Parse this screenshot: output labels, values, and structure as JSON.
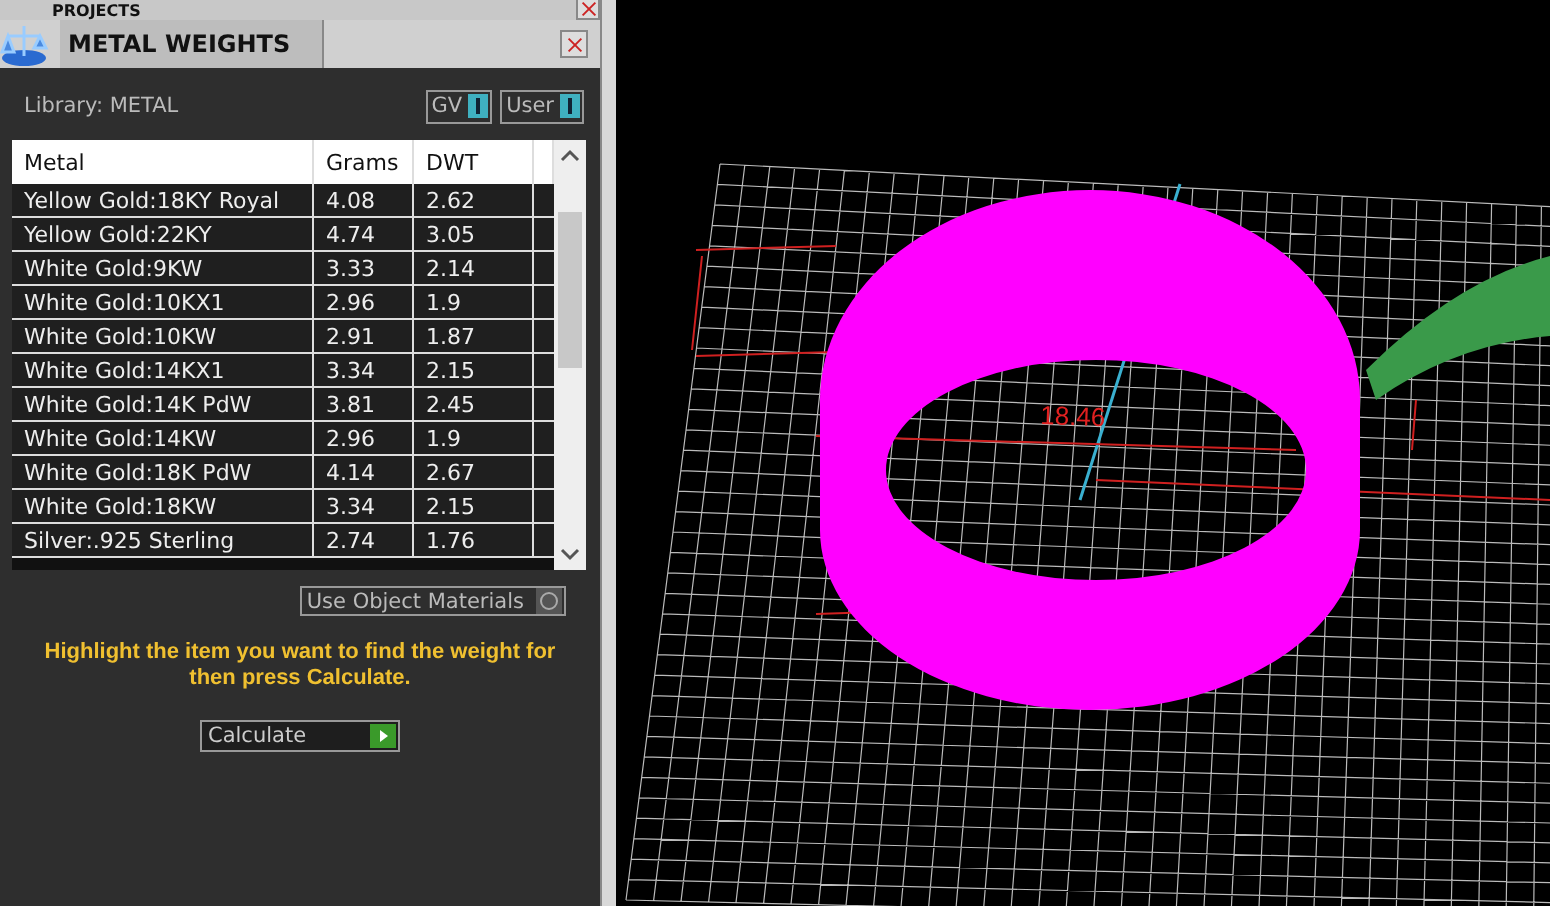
{
  "panel_header": {
    "title": "PROJECTS"
  },
  "tool": {
    "title": "METAL WEIGHTS"
  },
  "library": {
    "label": "Library: METAL"
  },
  "toggles": [
    {
      "label": "GV",
      "on": true
    },
    {
      "label": "User",
      "on": true
    }
  ],
  "table": {
    "columns": [
      "Metal",
      "Grams",
      "DWT"
    ],
    "rows": [
      [
        "Yellow Gold:18KY Royal",
        "4.08",
        "2.62"
      ],
      [
        "Yellow Gold:22KY",
        "4.74",
        "3.05"
      ],
      [
        "White Gold:9KW",
        "3.33",
        "2.14"
      ],
      [
        "White Gold:10KX1",
        "2.96",
        "1.9"
      ],
      [
        "White Gold:10KW",
        "2.91",
        "1.87"
      ],
      [
        "White Gold:14KX1",
        "3.34",
        "2.15"
      ],
      [
        "White Gold:14K PdW",
        "3.81",
        "2.45"
      ],
      [
        "White Gold:14KW",
        "2.96",
        "1.9"
      ],
      [
        "White Gold:18K PdW",
        "4.14",
        "2.67"
      ],
      [
        "White Gold:18KW",
        "3.34",
        "2.15"
      ],
      [
        "Silver:.925 Sterling",
        "2.74",
        "1.76"
      ]
    ]
  },
  "use_object_materials": {
    "label": "Use Object Materials",
    "on": false
  },
  "instruction": "Highlight the item you want to find the weight for then press Calculate.",
  "calculate": {
    "label": "Calculate"
  },
  "viewport": {
    "dimension_label": "18.46"
  }
}
